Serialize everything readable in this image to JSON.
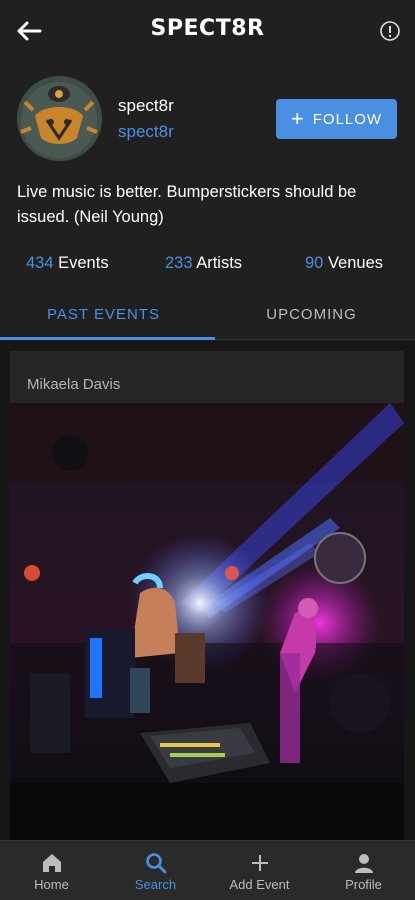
{
  "header": {
    "logo_text": "SPECT8R",
    "back_icon": "arrow-left-icon",
    "info_icon": "info-icon"
  },
  "profile": {
    "display_name": "spect8r",
    "handle": "spect8r",
    "follow_label": "FOLLOW",
    "bio": "Live music is better. Bumperstickers should be issued. (Neil Young)",
    "stats": [
      {
        "count": "434",
        "label": "Events"
      },
      {
        "count": "233",
        "label": "Artists"
      },
      {
        "count": "90",
        "label": "Venues"
      }
    ]
  },
  "tabs": {
    "past": "PAST EVENTS",
    "upcoming": "UPCOMING"
  },
  "feed": {
    "card_title": "Mikaela Davis"
  },
  "bottom_nav": [
    {
      "label": "Home",
      "icon": "home-icon"
    },
    {
      "label": "Search",
      "icon": "search-icon"
    },
    {
      "label": "Add Event",
      "icon": "plus-icon"
    },
    {
      "label": "Profile",
      "icon": "user-icon"
    }
  ],
  "colors": {
    "accent": "#4a90e2",
    "background": "#202020",
    "text": "#ffffff",
    "muted": "#bdbdbd"
  }
}
